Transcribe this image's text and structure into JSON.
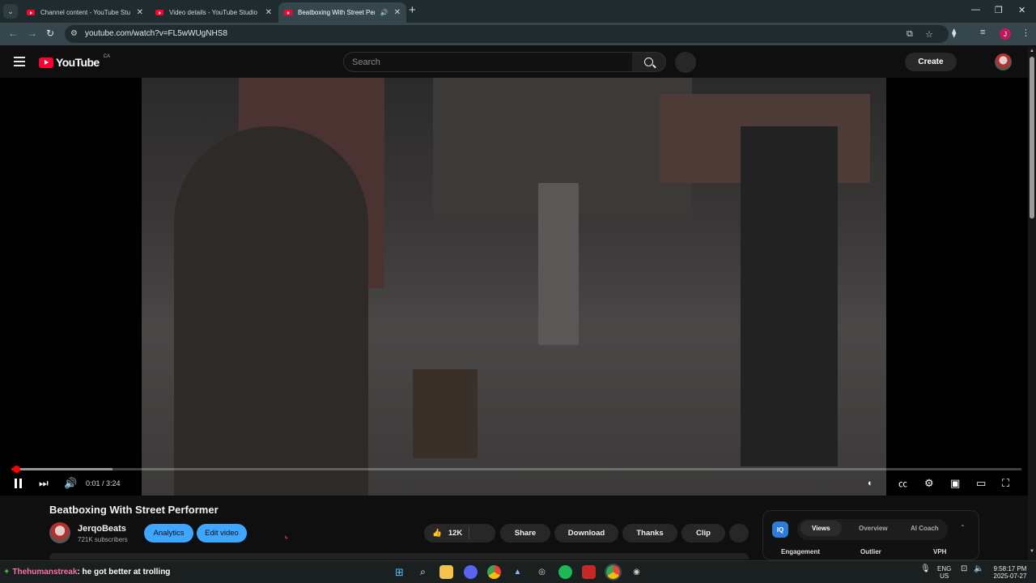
{
  "browser": {
    "tabs": [
      {
        "title": "Channel content - YouTube Stu",
        "active": false
      },
      {
        "title": "Video details - YouTube Studio",
        "active": false
      },
      {
        "title": "Beatboxing With Street Perf",
        "active": true,
        "audio": true
      }
    ],
    "url": "youtube.com/watch?v=FL5wWUgNHS8"
  },
  "youtube": {
    "country": "CA",
    "search_placeholder": "Search",
    "create_label": "Create"
  },
  "player": {
    "current_time": "0:01",
    "duration": "3:24",
    "progress_fraction": 0.005,
    "buffered_fraction": 0.1
  },
  "video": {
    "title": "Beatboxing With Street Performer",
    "channel_name": "JerqoBeats",
    "subscribers": "721K subscribers",
    "analytics_label": "Analytics",
    "edit_label": "Edit video",
    "likes": "12K",
    "share_label": "Share",
    "download_label": "Download",
    "thanks_label": "Thanks",
    "clip_label": "Clip"
  },
  "vidiq": {
    "logo": "IQ",
    "tabs": [
      "Views",
      "Overview",
      "AI Coach"
    ],
    "active_tab": "Views",
    "columns": [
      "Engagement",
      "Outlier",
      "VPH"
    ]
  },
  "taskbar": {
    "chat_user": "Thehumanstreak",
    "chat_message": ": he got better at trolling",
    "lang_top": "ENG",
    "lang_bottom": "US",
    "clock_time": "9:58:17 PM",
    "clock_date": "2025-07-27"
  },
  "colors": {
    "accent_red": "#ff0000",
    "button_blue": "#3ea6ff",
    "browser_chrome": "#35474c"
  }
}
